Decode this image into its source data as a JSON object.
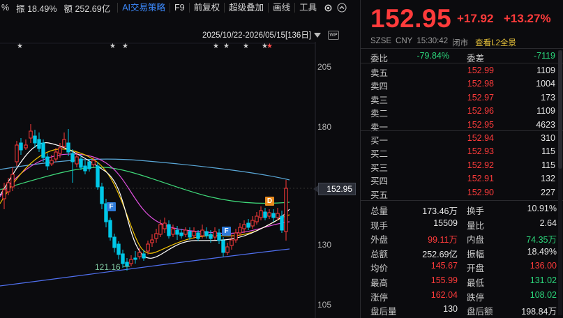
{
  "topbar": {
    "percent_tail": "%",
    "amplitude": "振 18.49%",
    "turnover": "额 252.69亿",
    "tools": [
      "AI交易策略",
      "F9",
      "前复权",
      "超级叠加",
      "画线",
      "工具"
    ]
  },
  "range": {
    "label": "2025/10/22-2026/05/15[136日]",
    "wp_badge": "WP"
  },
  "chart": {
    "y_ticks": [
      "205",
      "180",
      "130",
      "105"
    ],
    "current_price_tag": "152.95",
    "min_label": "121.16",
    "flags": [
      {
        "letter": "F"
      },
      {
        "letter": "F"
      },
      {
        "letter": "D"
      }
    ],
    "colors": {
      "up": "#ff3b3b",
      "down": "#00c8e8",
      "ma5": "#ffffff",
      "ma10": "#f0c000",
      "ma20": "#e050e0",
      "ma60": "#3fd97a",
      "ma120": "#5aa8d8",
      "ma250": "#5070f0"
    }
  },
  "quote": {
    "price": "152.95",
    "change": "+17.92",
    "change_pct": "+13.27%",
    "exchange": "SZSE",
    "currency": "CNY",
    "time": "15:30:42",
    "status": "闭市",
    "l2_link": "查看L2全景",
    "ratio_label": "委比",
    "ratio_value": "-79.84%",
    "diff_label": "委差",
    "diff_value": "-7119",
    "asks": [
      {
        "label": "卖五",
        "price": "152.99",
        "volume": "1109"
      },
      {
        "label": "卖四",
        "price": "152.98",
        "volume": "1004"
      },
      {
        "label": "卖三",
        "price": "152.97",
        "volume": "173"
      },
      {
        "label": "卖二",
        "price": "152.96",
        "volume": "1109"
      },
      {
        "label": "卖一",
        "price": "152.95",
        "volume": "4623"
      }
    ],
    "bids": [
      {
        "label": "买一",
        "price": "152.94",
        "volume": "310"
      },
      {
        "label": "买二",
        "price": "152.93",
        "volume": "115"
      },
      {
        "label": "买三",
        "price": "152.92",
        "volume": "115"
      },
      {
        "label": "买四",
        "price": "152.91",
        "volume": "132"
      },
      {
        "label": "买五",
        "price": "152.90",
        "volume": "227"
      }
    ],
    "stats": [
      {
        "l1": "总量",
        "v1": "173.46万",
        "c1": "white",
        "l2": "换手",
        "v2": "10.91%",
        "c2": "white"
      },
      {
        "l1": "现手",
        "v1": "15509",
        "c1": "white",
        "l2": "量比",
        "v2": "2.64",
        "c2": "white"
      },
      {
        "l1": "外盘",
        "v1": "99.11万",
        "c1": "red",
        "l2": "内盘",
        "v2": "74.35万",
        "c2": "green"
      },
      {
        "l1": "总额",
        "v1": "252.69亿",
        "c1": "white",
        "l2": "振幅",
        "v2": "18.49%",
        "c2": "white"
      },
      {
        "l1": "均价",
        "v1": "145.67",
        "c1": "red",
        "l2": "开盘",
        "v2": "136.00",
        "c2": "red"
      },
      {
        "l1": "最高",
        "v1": "155.99",
        "c1": "red",
        "l2": "最低",
        "v2": "131.02",
        "c2": "green"
      },
      {
        "l1": "涨停",
        "v1": "162.04",
        "c1": "red",
        "l2": "跌停",
        "v2": "108.02",
        "c2": "green"
      },
      {
        "l1": "盘后量",
        "v1": "130",
        "c1": "white",
        "l2": "盘后额",
        "v2": "198.84万",
        "c2": "white"
      }
    ]
  }
}
